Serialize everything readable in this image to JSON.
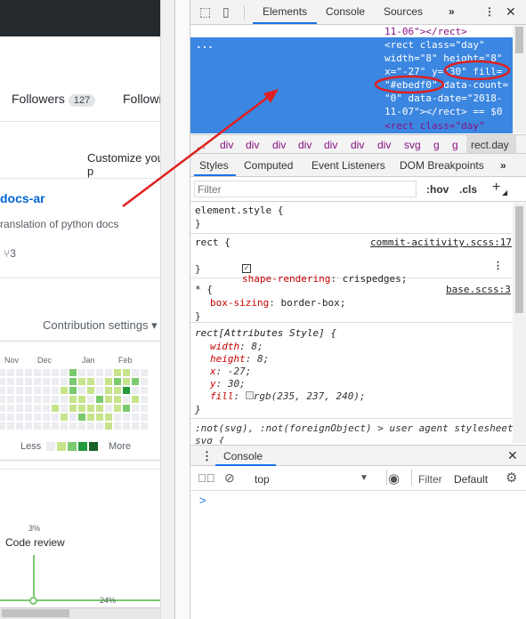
{
  "github": {
    "followers_label": "Followers",
    "followers_count": "127",
    "following_label": "Following",
    "customize_label": "Customize your p",
    "repo_name": "docs-ar",
    "repo_desc": "ranslation of python docs",
    "fork_count": "3",
    "contribution_settings": "Contribution settings",
    "months": [
      "Nov",
      "Dec",
      "Jan",
      "Feb"
    ],
    "legend_less": "Less",
    "legend_more": "More",
    "code_review_pct": "3%",
    "code_review_label": "Code review",
    "bottom_pct": "24%"
  },
  "devtools": {
    "tabs": [
      "Elements",
      "Console",
      "Sources"
    ],
    "active_tab": "Elements",
    "code_lines": [
      "11-06\"></rect>",
      "<rect class=\"day\"",
      "width=\"8\" height=\"8\"",
      "x=\"-27\" y=\"30\" fill=",
      "\"#ebedf0\" data-count=",
      "\"0\" data-date=\"2018-",
      "11-07\"></rect> == $0",
      "<rect class=\"day\""
    ],
    "ellipsis": "...",
    "breadcrumb": [
      "...",
      "div",
      "div",
      "div",
      "div",
      "div",
      "div",
      "div",
      "svg",
      "g",
      "g",
      "rect.day"
    ],
    "subtabs": [
      "Styles",
      "Computed",
      "Event Listeners",
      "DOM Breakpoints"
    ],
    "filter_placeholder": "Filter",
    "hov": ":hov",
    "cls": ".cls",
    "element_style": "element.style {",
    "rule1": {
      "selector": "rect {",
      "source": "commit-acitivity.scss:17",
      "prop": "shape-rendering",
      "value": "crispedges;"
    },
    "rule2": {
      "selector": "* {",
      "source": "base.scss:3",
      "prop": "box-sizing",
      "value": "border-box;"
    },
    "rule3": {
      "selector": "rect[Attributes Style] {",
      "props": [
        {
          "prop": "width",
          "value": "8;"
        },
        {
          "prop": "height",
          "value": "8;"
        },
        {
          "prop": "x",
          "value": "-27;"
        },
        {
          "prop": "y",
          "value": "30;"
        },
        {
          "prop": "fill",
          "value": "rgb(235, 237, 240);"
        }
      ]
    },
    "rule4": {
      "selector": ":not(svg), :not(foreignObject) > user agent stylesheet",
      "next": "svg {"
    },
    "close_brace": "}",
    "console_tab": "Console",
    "context": "top",
    "console_filter": "Filter",
    "levels": "Default",
    "prompt": ">"
  },
  "colors": {
    "selection": "#3b86e0",
    "annotation": "#e02020",
    "swatch": "#ebedf0"
  }
}
